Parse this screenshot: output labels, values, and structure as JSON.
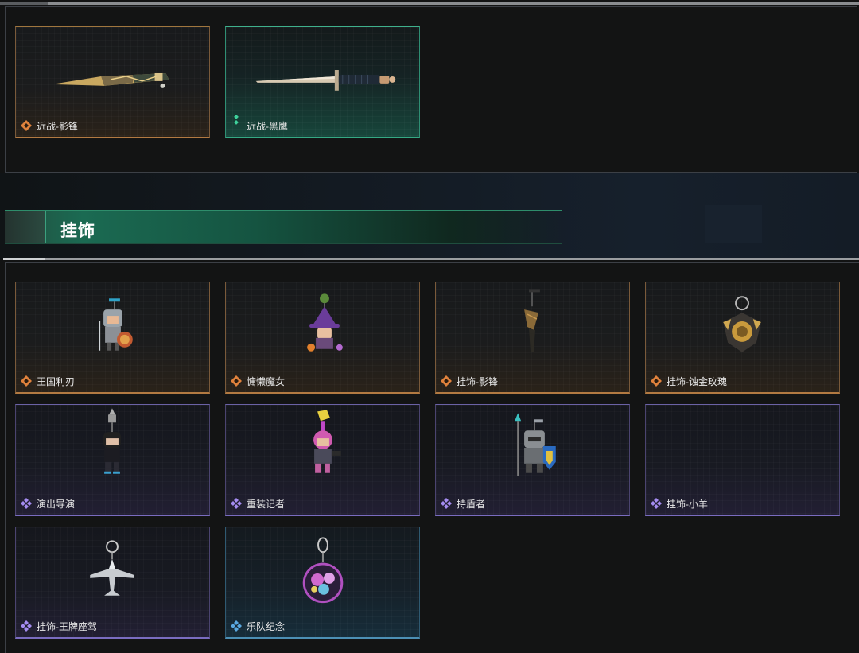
{
  "melee_section": {
    "items": [
      {
        "name": "近战-影锋",
        "rarity": "orange",
        "icon": "rarity-diamond-icon"
      },
      {
        "name": "近战-黑鹰",
        "rarity": "green",
        "icon": "rarity-double-diamond-icon"
      }
    ]
  },
  "charms_section": {
    "title": "挂饰",
    "items": [
      {
        "name": "王国利刃",
        "rarity": "orange",
        "icon": "rarity-diamond-icon"
      },
      {
        "name": "慵懒魔女",
        "rarity": "orange",
        "icon": "rarity-diamond-icon"
      },
      {
        "name": "挂饰-影锋",
        "rarity": "orange",
        "icon": "rarity-diamond-icon"
      },
      {
        "name": "挂饰-蚀金玫瑰",
        "rarity": "orange",
        "icon": "rarity-diamond-icon"
      },
      {
        "name": "演出导演",
        "rarity": "purple",
        "icon": "rarity-cluster-icon"
      },
      {
        "name": "重装记者",
        "rarity": "purple",
        "icon": "rarity-cluster-icon"
      },
      {
        "name": "持盾者",
        "rarity": "purple",
        "icon": "rarity-cluster-icon"
      },
      {
        "name": "挂饰-小羊",
        "rarity": "purple",
        "icon": "rarity-cluster-icon"
      },
      {
        "name": "挂饰-王牌座驾",
        "rarity": "purple",
        "icon": "rarity-cluster-icon"
      },
      {
        "name": "乐队纪念",
        "rarity": "blue",
        "icon": "rarity-cluster-icon"
      }
    ]
  },
  "colors": {
    "orange": "#e0823c",
    "green": "#3fd29c",
    "purple": "#a48cf0",
    "blue": "#5aa8e0",
    "header_green": "#1b6a52"
  }
}
